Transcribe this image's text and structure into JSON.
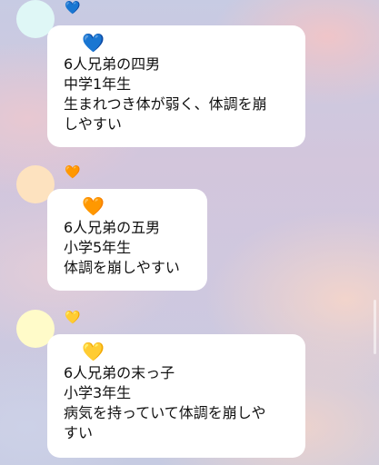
{
  "messages": [
    {
      "avatar_color": "#dff7f6",
      "heart_icon": "blue-heart-icon",
      "heart_glyph": "💙",
      "heart_color": "#2f7ef0",
      "lines": [
        "6人兄弟の四男",
        "中学1年生",
        "生まれつき体が弱く、体調を崩",
        "しやすい"
      ]
    },
    {
      "avatar_color": "#fde2bf",
      "heart_icon": "orange-heart-icon",
      "heart_glyph": "🧡",
      "heart_color": "#f08a1a",
      "lines": [
        "6人兄弟の五男",
        "小学5年生",
        "体調を崩しやすい"
      ]
    },
    {
      "avatar_color": "#fffbc9",
      "heart_icon": "yellow-heart-icon",
      "heart_glyph": "💛",
      "heart_color": "#f5c23a",
      "lines": [
        "6人兄弟の末っ子",
        "小学3年生",
        "病気を持っていて体調を崩しや",
        "すい"
      ]
    }
  ]
}
